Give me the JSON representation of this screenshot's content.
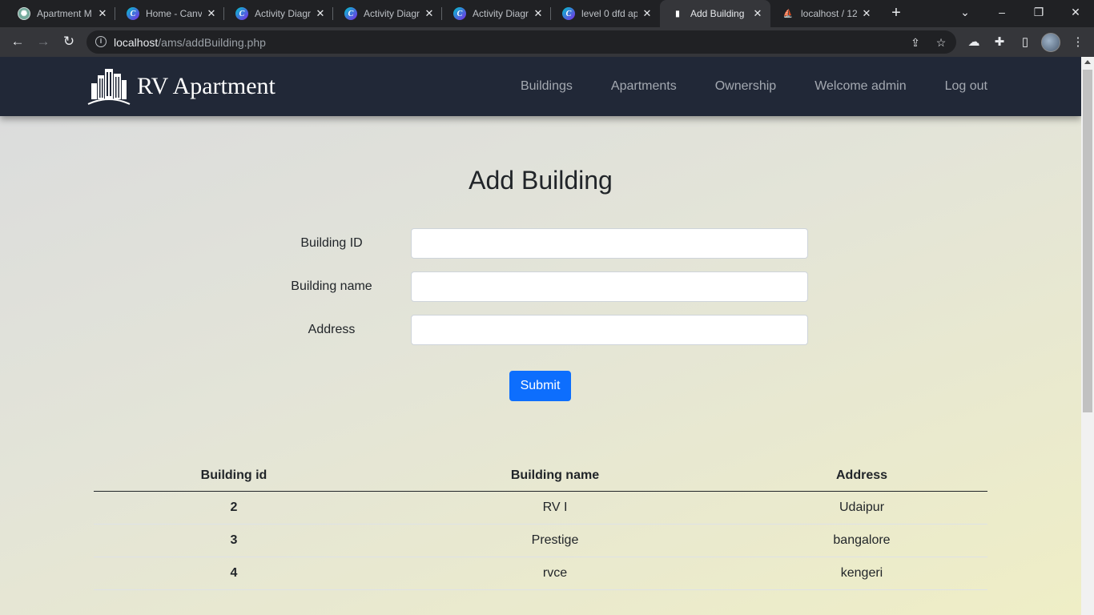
{
  "browser": {
    "tabs": [
      {
        "title": "Apartment M",
        "favicon": "chatgpt-icon",
        "active": false
      },
      {
        "title": "Home - Canva",
        "favicon": "canva-icon",
        "active": false
      },
      {
        "title": "Activity Diagr",
        "favicon": "canva-icon",
        "active": false
      },
      {
        "title": "Activity Diagr",
        "favicon": "canva-icon",
        "active": false
      },
      {
        "title": "Activity Diagr",
        "favicon": "canva-icon",
        "active": false
      },
      {
        "title": "level 0 dfd ap",
        "favicon": "canva-icon",
        "active": false
      },
      {
        "title": "Add Building",
        "favicon": "building-icon",
        "active": true
      },
      {
        "title": "localhost / 12",
        "favicon": "phpmyadmin-icon",
        "active": false
      }
    ],
    "address": {
      "host": "localhost",
      "path": "/ams/addBuilding.php"
    }
  },
  "navbar": {
    "brand": "RV Apartment",
    "links": [
      "Buildings",
      "Apartments",
      "Ownership",
      "Welcome admin",
      "Log out"
    ]
  },
  "form": {
    "title": "Add Building",
    "fields": [
      {
        "label": "Building ID",
        "value": ""
      },
      {
        "label": "Building name",
        "value": ""
      },
      {
        "label": "Address",
        "value": ""
      }
    ],
    "submit_label": "Submit"
  },
  "table": {
    "headers": [
      "Building id",
      "Building name",
      "Address"
    ],
    "rows": [
      [
        "2",
        "RV I",
        "Udaipur"
      ],
      [
        "3",
        "Prestige",
        "bangalore"
      ],
      [
        "4",
        "rvce",
        "kengeri"
      ]
    ]
  },
  "colors": {
    "navbar_bg": "#212837",
    "primary_button": "#0d6efd"
  }
}
